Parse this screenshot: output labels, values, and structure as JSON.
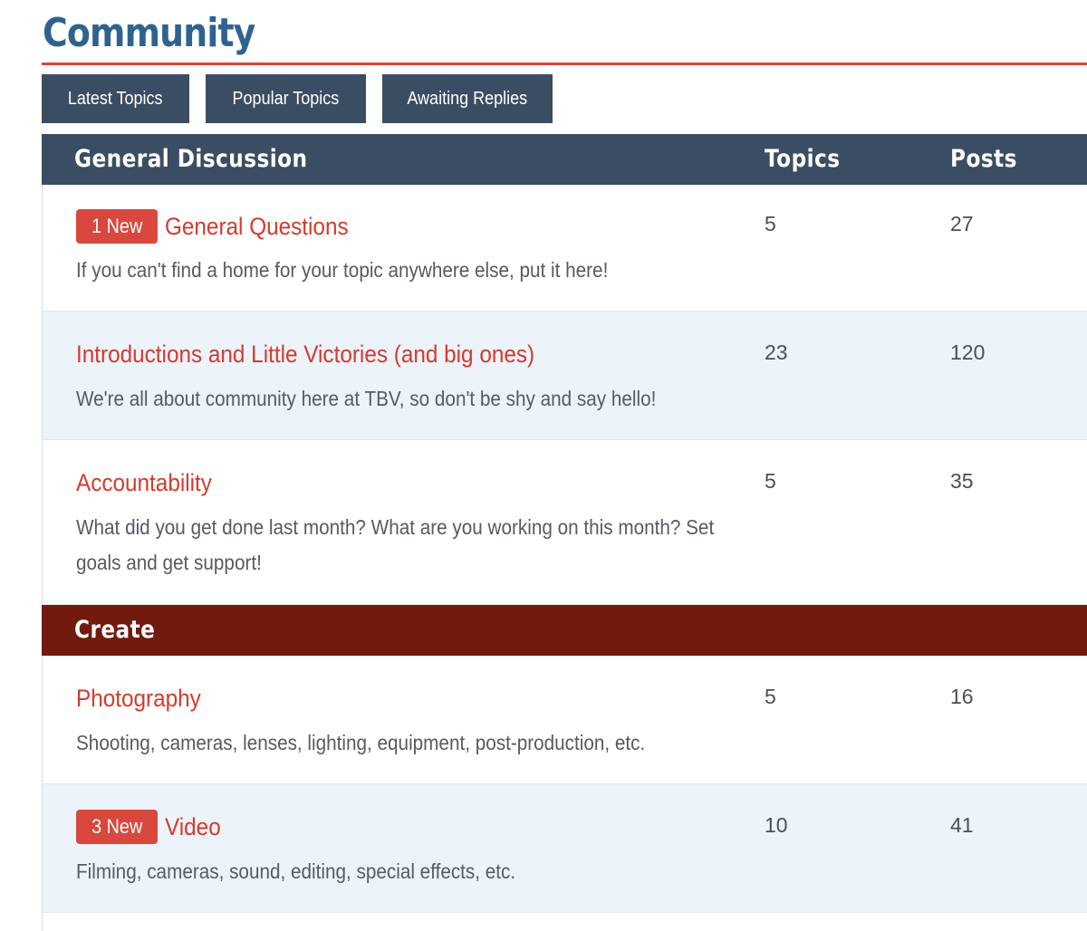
{
  "page": {
    "title": "Community"
  },
  "tabs": [
    {
      "label": "Latest Topics"
    },
    {
      "label": "Popular Topics"
    },
    {
      "label": "Awaiting Replies"
    }
  ],
  "colors": {
    "title": "#2e6390",
    "accent_rule": "#d9473a",
    "tab_bg": "#3b4d63",
    "general_header_bg": "#3b4d63",
    "create_header_bg": "#711a0e",
    "badge_bg": "#d9483e",
    "link": "#d63a2c",
    "alt_row_bg": "#edf3fa"
  },
  "sections": [
    {
      "name": "General Discussion",
      "columns": {
        "topics": "Topics",
        "posts": "Posts"
      },
      "forums": [
        {
          "badge": "1 New",
          "title": "General Questions",
          "description": "If you can't find a home for your topic anywhere else, put it here!",
          "topics": "5",
          "posts": "27"
        },
        {
          "badge": "",
          "title": "Introductions and Little Victories (and big ones)",
          "description": "We're all about community here at TBV, so don't be shy and say hello!",
          "topics": "23",
          "posts": "120"
        },
        {
          "badge": "",
          "title": "Accountability",
          "description": "What did you get done last month? What are you working on this month? Set goals and get support!",
          "topics": "5",
          "posts": "35"
        }
      ]
    },
    {
      "name": "Create",
      "forums": [
        {
          "badge": "",
          "title": "Photography",
          "description": "Shooting, cameras, lenses, lighting, equipment, post-production, etc.",
          "topics": "5",
          "posts": "16"
        },
        {
          "badge": "3 New",
          "title": "Video",
          "description": "Filming, cameras, sound, editing, special effects, etc.",
          "topics": "10",
          "posts": "41"
        }
      ]
    }
  ]
}
